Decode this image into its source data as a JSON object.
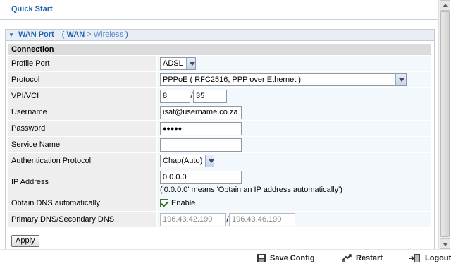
{
  "header": {
    "quick_start": "Quick Start"
  },
  "panel": {
    "title": "WAN Port",
    "breadcrumb_open": "(",
    "breadcrumb_wan": "WAN",
    "breadcrumb_sep": ">",
    "breadcrumb_wireless": "Wireless",
    "breadcrumb_close": ")",
    "section": "Connection"
  },
  "form": {
    "profile_port": {
      "label": "Profile Port",
      "value": "ADSL"
    },
    "protocol": {
      "label": "Protocol",
      "value": "PPPoE ( RFC2516, PPP over Ethernet )"
    },
    "vpi_vci": {
      "label": "VPI/VCI",
      "vpi": "8",
      "separator": "/",
      "vci": "35"
    },
    "username": {
      "label": "Username",
      "value": "isat@username.co.za"
    },
    "password": {
      "label": "Password",
      "value": "●●●●●"
    },
    "service_name": {
      "label": "Service Name",
      "value": ""
    },
    "auth_protocol": {
      "label": "Authentication Protocol",
      "value": "Chap(Auto)"
    },
    "ip_address": {
      "label": "IP Address",
      "value": "0.0.0.0",
      "note": "('0.0.0.0' means 'Obtain an IP address automatically')"
    },
    "obtain_dns": {
      "label": "Obtain DNS automatically",
      "checkbox_label": "Enable",
      "checked": true
    },
    "dns": {
      "label": "Primary DNS/Secondary DNS",
      "primary": "196.43.42.190",
      "separator": "/",
      "secondary": "196.43.46.190"
    }
  },
  "buttons": {
    "apply": "Apply"
  },
  "bottom": {
    "save_config": "Save Config",
    "restart": "Restart",
    "logout": "Logout"
  }
}
